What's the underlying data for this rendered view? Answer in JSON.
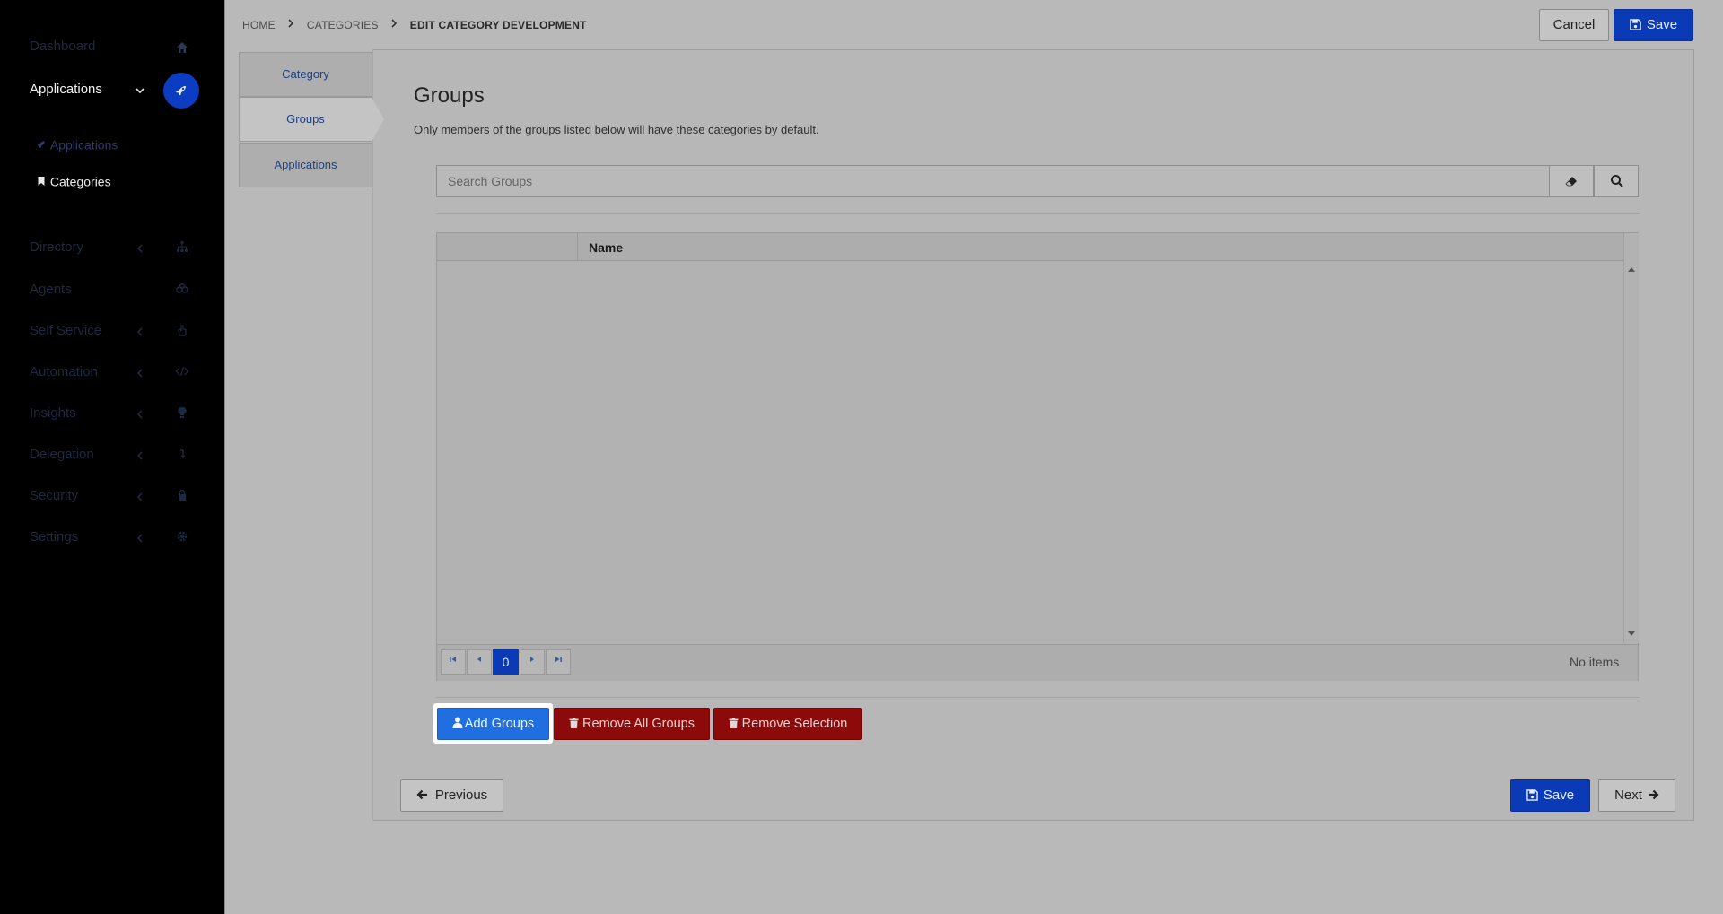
{
  "sidebar": {
    "items": [
      {
        "label": "Dashboard",
        "icon": "home-icon"
      },
      {
        "label": "Applications",
        "icon": "rocket-icon",
        "active": true
      },
      {
        "label": "Directory",
        "icon": "sitemap-icon"
      },
      {
        "label": "Agents",
        "icon": "agents-icon"
      },
      {
        "label": "Self Service",
        "icon": "hand-icon"
      },
      {
        "label": "Automation",
        "icon": "code-icon"
      },
      {
        "label": "Insights",
        "icon": "lightbulb-icon"
      },
      {
        "label": "Delegation",
        "icon": "delegation-icon"
      },
      {
        "label": "Security",
        "icon": "lock-icon"
      },
      {
        "label": "Settings",
        "icon": "gear-icon"
      }
    ],
    "sub_items": [
      {
        "label": "Applications",
        "icon": "rocket-icon"
      },
      {
        "label": "Categories",
        "icon": "bookmark-icon"
      }
    ]
  },
  "breadcrumb": {
    "home": "HOME",
    "categories": "CATEGORIES",
    "current": "EDIT CATEGORY DEVELOPMENT"
  },
  "header": {
    "cancel_label": "Cancel",
    "save_label": "Save"
  },
  "tabs": [
    {
      "label": "Category"
    },
    {
      "label": "Groups",
      "selected": true
    },
    {
      "label": "Applications"
    }
  ],
  "section": {
    "title": "Groups",
    "description": "Only members of the groups listed below will have these categories by default."
  },
  "search": {
    "placeholder": "Search Groups"
  },
  "grid": {
    "columns": [
      "",
      "Name"
    ],
    "rows": [],
    "page": "0",
    "status": "No items"
  },
  "actions": {
    "add_label": "Add Groups",
    "remove_all_label": "Remove All Groups",
    "remove_selection_label": "Remove Selection"
  },
  "footer": {
    "previous_label": "Previous",
    "save_label": "Save",
    "next_label": "Next"
  },
  "colors": {
    "primary": "#0b3ab7",
    "danger": "#8c0a0a",
    "add": "#1f6fe0",
    "sidebar_bg": "#000000"
  }
}
